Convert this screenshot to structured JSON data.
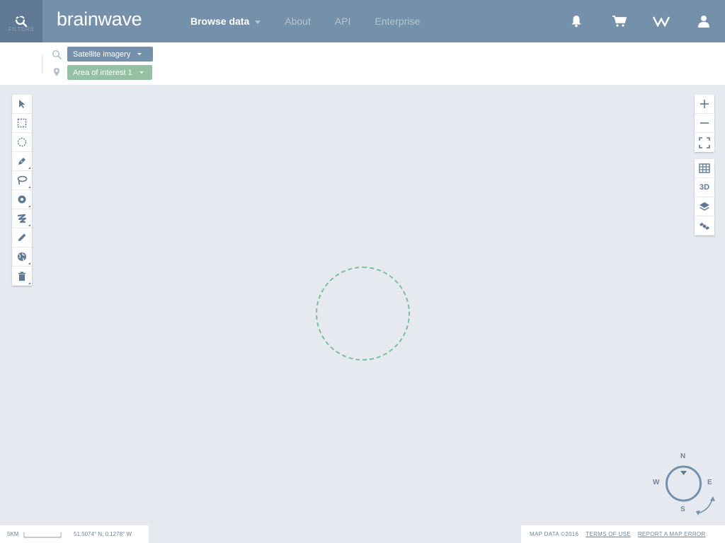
{
  "app": {
    "logo_text": "brainwave",
    "accent_color": "#7590aa",
    "header_dark_color": "#5f7893",
    "aoi_color": "#94c0a3"
  },
  "header": {
    "nav": [
      {
        "label": "Browse data",
        "active": true,
        "has_dropdown": true
      },
      {
        "label": "About",
        "active": false
      },
      {
        "label": "API",
        "active": false
      },
      {
        "label": "Enterprise",
        "active": false
      }
    ],
    "icons": [
      "search-icon",
      "bell-icon",
      "cart-icon",
      "brand-mark-icon",
      "user-icon"
    ]
  },
  "filterbar": {
    "filters_label": "FILTERS",
    "imagery_chip": "Satellite imagery",
    "aoi_chip": "Area of interest 1"
  },
  "draw_tools": [
    "pointer-icon",
    "rectangle-select-icon",
    "circle-select-icon",
    "pen-icon",
    "lasso-icon",
    "point-icon",
    "freehand-icon",
    "pencil-icon",
    "globe-icon",
    "trash-icon"
  ],
  "map_controls": {
    "zoom": [
      "zoom-in-icon",
      "zoom-out-icon",
      "fullscreen-icon"
    ],
    "view": [
      "grid-icon",
      "3d-toggle",
      "layers-icon",
      "satellite-icon"
    ],
    "label_3d": "3D"
  },
  "compass": {
    "n": "N",
    "e": "E",
    "s": "S",
    "w": "W"
  },
  "footer": {
    "scale_label": "5KM",
    "coordinates": "51.5074° N, 0.1278° W",
    "map_data": "MAP DATA ©2016",
    "terms": "TERMS OF USE",
    "report": "REPORT A MAP ERROR"
  }
}
